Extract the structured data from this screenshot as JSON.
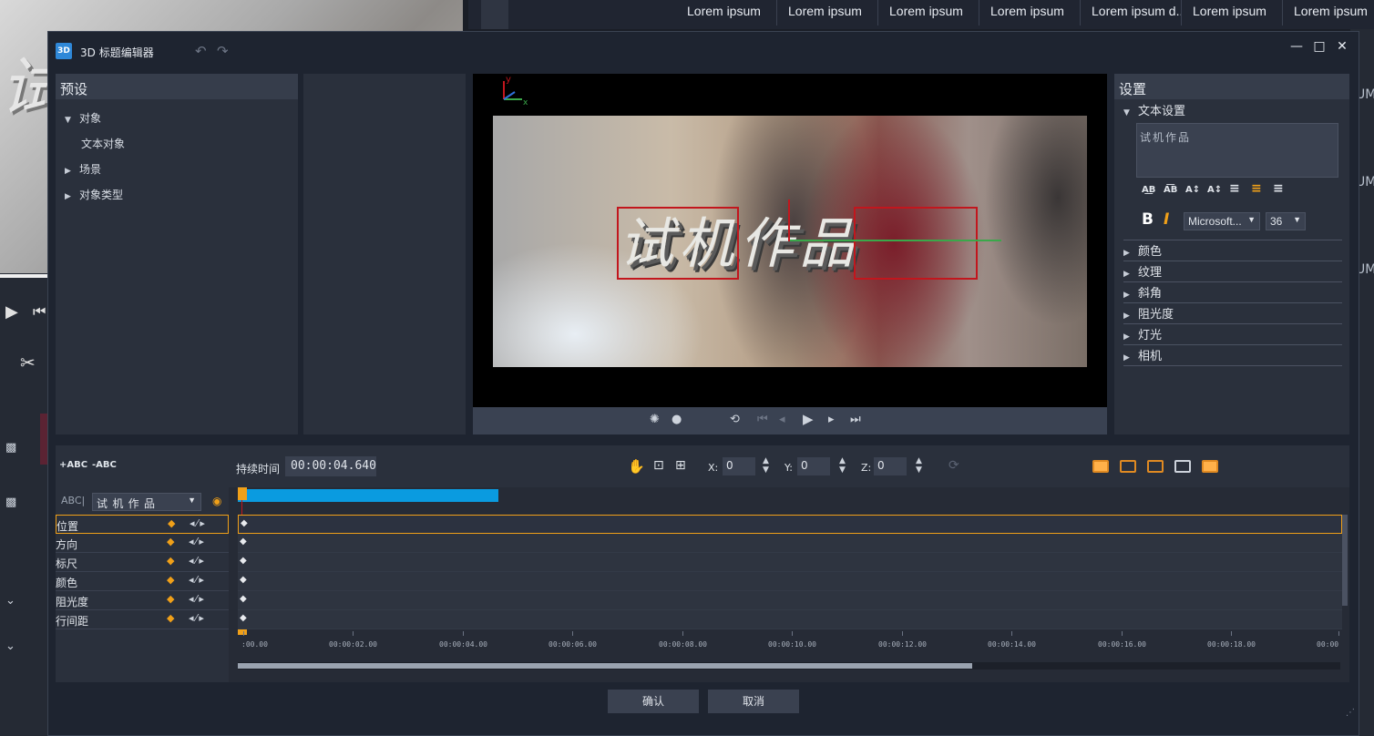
{
  "background": {
    "columns": [
      "Lorem ipsum",
      "Lorem ipsum",
      "Lorem ipsum",
      "Lorem ipsum",
      "Lorem ipsum d...",
      "Lorem ipsum",
      "Lorem ipsum"
    ],
    "preview_text": "试机",
    "right_edge_text": [
      "UM",
      "UM",
      "UM"
    ]
  },
  "dialog": {
    "app_icon": "3D",
    "title": "3D 标题编辑器",
    "presets": {
      "header": "预设",
      "items": [
        {
          "label": "对象",
          "expanded": true
        },
        {
          "label": "文本对象"
        },
        {
          "label": "场景",
          "expanded": false
        },
        {
          "label": "对象类型",
          "expanded": false
        }
      ]
    },
    "preview": {
      "title_text": "试机作品",
      "gizmo_y": "y",
      "gizmo_x": "x"
    },
    "settings": {
      "header": "设置",
      "text_settings": "文本设置",
      "text_value": "试机作品",
      "bold": "B",
      "italic": "I",
      "font": "Microsoft...",
      "font_size": "36",
      "sections": [
        "颜色",
        "纹理",
        "斜角",
        "阻光度",
        "灯光",
        "相机"
      ]
    },
    "toolbar": {
      "add_abc": "+ABC",
      "remove_abc": "-ABC",
      "duration_label": "持续时间",
      "duration_value": "00:00:04.640",
      "x_label": "X:",
      "x_value": "0",
      "y_label": "Y:",
      "y_value": "0",
      "z_label": "Z:",
      "z_value": "0"
    },
    "timeline": {
      "object_prefix": "ABC|",
      "object_value": "试 机 作 品",
      "tracks": [
        "位置",
        "方向",
        "标尺",
        "颜色",
        "阻光度",
        "行间距"
      ],
      "ruler": [
        ":00.00",
        "00:00:02.00",
        "00:00:04.00",
        "00:00:06.00",
        "00:00:08.00",
        "00:00:10.00",
        "00:00:12.00",
        "00:00:14.00",
        "00:00:16.00",
        "00:00:18.00",
        "00:00"
      ]
    },
    "buttons": {
      "ok": "确认",
      "cancel": "取消"
    }
  },
  "colors": {
    "accent": "#f0a019",
    "timeline_bar": "#0a9be0",
    "selection": "#c2161d"
  }
}
